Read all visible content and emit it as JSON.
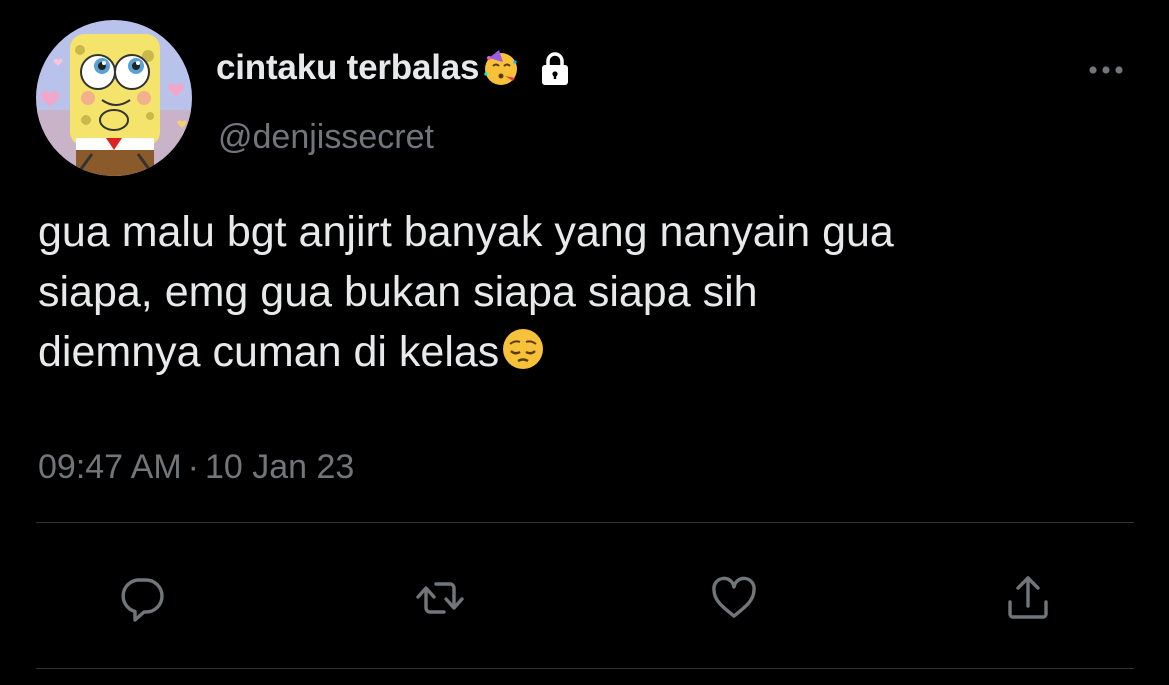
{
  "author": {
    "display_name": "cintaku terbalas",
    "name_emoji": "partying-face-emoji",
    "protected_icon": "lock-icon",
    "handle": "@denjissecret",
    "avatar": "spongebob-avatar"
  },
  "tweet": {
    "lines": [
      "gua malu bgt anjirt banyak yang nanyain gua",
      "siapa, emg gua bukan siapa siapa sih",
      "diemnya cuman di kelas"
    ],
    "trailing_emoji": "pensive-face-emoji",
    "time": "09:47 AM",
    "separator": "·",
    "date": "10 Jan 23"
  },
  "actions": {
    "reply_icon": "reply-icon",
    "retweet_icon": "retweet-icon",
    "like_icon": "heart-icon",
    "share_icon": "share-icon",
    "more_icon": "more-icon"
  },
  "colors": {
    "background": "#000000",
    "primary_text": "#e7e9ea",
    "secondary_text": "#71767b",
    "divider": "#2f3336",
    "avatar_bg": "#b9c2ea",
    "spongebob_yellow": "#f4e46b"
  }
}
